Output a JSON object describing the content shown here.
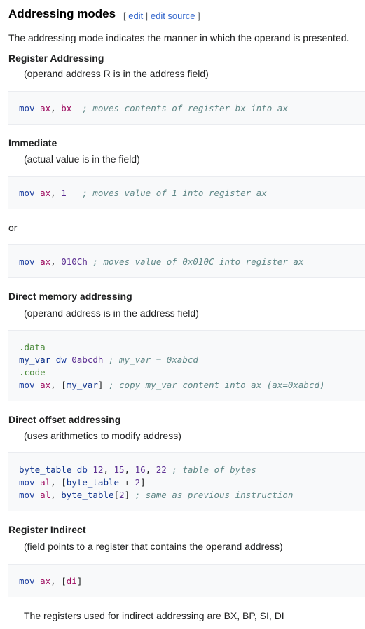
{
  "heading": "Addressing modes",
  "edit": {
    "open": "[",
    "edit": "edit",
    "sep": "|",
    "edit_source": "edit source",
    "close": "]"
  },
  "intro": "The addressing mode indicates the manner in which the operand is presented.",
  "register": {
    "title": "Register Addressing",
    "desc": "(operand address R is in the address field)",
    "code": {
      "kw": "mov",
      "reg1": "ax",
      "sep": ",",
      "reg2": "bx",
      "pad": "  ",
      "comment": "; moves contents of register bx into ax"
    }
  },
  "immediate": {
    "title": "Immediate",
    "desc": "(actual value is in the field)",
    "code1": {
      "kw": "mov",
      "reg": "ax",
      "sep": ",",
      "num": "1",
      "pad": "   ",
      "comment": "; moves value of 1 into register ax"
    },
    "or": "or",
    "code2": {
      "kw": "mov",
      "reg": "ax",
      "sep": ",",
      "num": "010Ch",
      "comment": "; moves value of 0x010C into register ax"
    }
  },
  "direct": {
    "title": "Direct memory addressing",
    "desc": "(operand address is in the address field)",
    "code": {
      "data": ".data",
      "var": "my_var",
      "dw": "dw",
      "hex": "0abcdh",
      "c1": "; my_var = 0xabcd",
      "codeseg": ".code",
      "kw": "mov",
      "reg": "ax",
      "open": "[",
      "ref": "my_var",
      "close": "]",
      "c2": "; copy my_var content into ax (ax=0xabcd)"
    }
  },
  "offset": {
    "title": "Direct offset addressing",
    "desc": "(uses arithmetics to modify address)",
    "code": {
      "lbl": "byte_table",
      "db": "db",
      "n1": "12",
      "n2": "15",
      "n3": "16",
      "n4": "22",
      "c1": "; table of bytes",
      "kw": "mov",
      "reg": "al",
      "open": "[",
      "ref": "byte_table",
      "plus": " + ",
      "two": "2",
      "close": "]",
      "ref2": "byte_table",
      "idx": "2",
      "c2": "; same as previous instruction"
    }
  },
  "indirect": {
    "title": "Register Indirect",
    "desc": "(field points to a register that contains the operand address)",
    "code": {
      "kw": "mov",
      "reg": "ax",
      "open": "[",
      "di": "di",
      "close": "]"
    },
    "note": "The registers used for indirect addressing are BX, BP, SI, DI"
  }
}
